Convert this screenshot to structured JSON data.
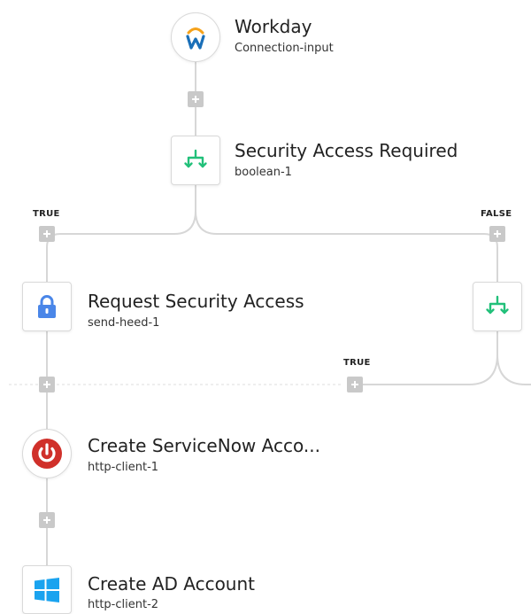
{
  "colors": {
    "line": "#d7d7d7",
    "add_button": "#c9c9c9",
    "workday_orange": "#f5a21a",
    "workday_blue": "#1a6fb8",
    "branch_green": "#22c07a",
    "lock_blue": "#4a86e8",
    "power_red": "#d0302a",
    "windows_blue": "#1aa3ef"
  },
  "nodes": {
    "workday": {
      "title": "Workday",
      "subtitle": "Connection-input",
      "icon": "workday-logo-icon"
    },
    "security_access_required": {
      "title": "Security Access Required",
      "subtitle": "boolean-1",
      "icon": "branch-icon"
    },
    "request_security_access": {
      "title": "Request Security Access",
      "subtitle": "send-heed-1",
      "icon": "lock-icon"
    },
    "false_branch_condition": {
      "icon": "branch-icon"
    },
    "create_servicenow_account": {
      "title": "Create ServiceNow Acco...",
      "subtitle": "http-client-1",
      "icon": "power-icon"
    },
    "create_ad_account": {
      "title": "Create AD Account",
      "subtitle": "http-client-2",
      "icon": "windows-logo-icon"
    }
  },
  "branches": {
    "true_label": "TRUE",
    "false_label": "FALSE",
    "inner_true_label": "TRUE"
  }
}
